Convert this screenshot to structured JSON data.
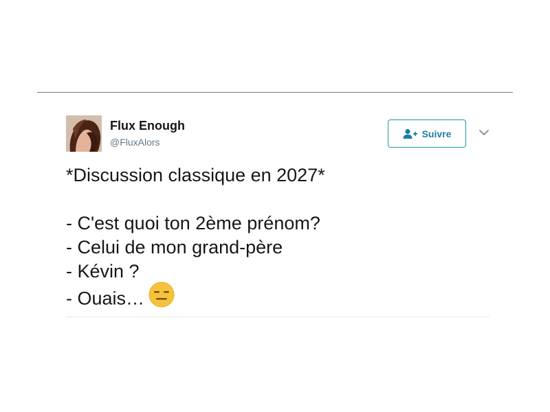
{
  "tweet": {
    "author": {
      "display_name": "Flux Enough",
      "handle": "@FluxAlors"
    },
    "follow_button": {
      "label": "Suivre",
      "icon": "add-user-icon"
    },
    "menu_icon": "chevron-down-icon",
    "text_lines": [
      "*Discussion classique en 2027*",
      "",
      "- C'est quoi ton 2ème prénom?",
      "- Celui de mon grand-père",
      "- Kévin ?",
      "- Ouais…"
    ],
    "trailing_emoji": "expressionless-face-emoji",
    "colors": {
      "accent": "#1b7ea3",
      "text": "#14171a",
      "secondary_text": "#657786",
      "emoji": "#f5c33b"
    }
  }
}
